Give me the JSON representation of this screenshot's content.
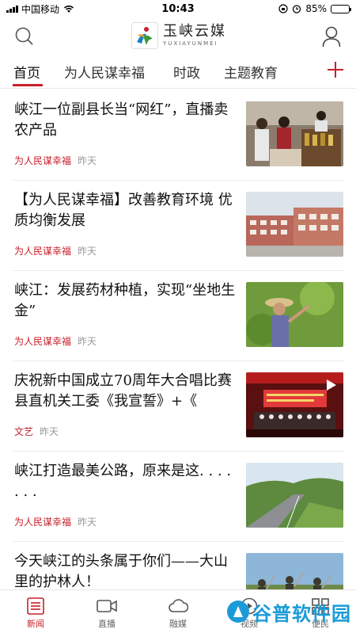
{
  "status": {
    "carrier": "中国移动",
    "time": "10:43",
    "battery": "85%",
    "battery_level": 0.85
  },
  "header": {
    "logo_cn": "玉峡云媒",
    "logo_en": "YUXIAYUNMEI"
  },
  "tabs": [
    {
      "label": "首页",
      "active": true
    },
    {
      "label": "为人民谋幸福",
      "active": false
    },
    {
      "label": "时政",
      "active": false
    },
    {
      "label": "主题教育",
      "active": false
    }
  ],
  "articles": [
    {
      "title": "峡江一位副县长当“网红”，直播卖农产品",
      "category": "为人民谋幸福",
      "time": "昨天",
      "thumb": "market"
    },
    {
      "title": "【为人民谋幸福】改善教育环境 优质均衡发展",
      "category": "为人民谋幸福",
      "time": "昨天",
      "thumb": "school"
    },
    {
      "title": "峡江：发展药材种植，实现“坐地生金”",
      "category": "为人民谋幸福",
      "time": "昨天",
      "thumb": "farmer"
    },
    {
      "title": "庆祝新中国成立70周年大合唱比赛 县直机关工委《我宣誓》+《",
      "category": "文艺",
      "time": "昨天",
      "thumb": "stage"
    },
    {
      "title": "峡江打造最美公路，原来是这. . . . . . .",
      "category": "为人民谋幸福",
      "time": "昨天",
      "thumb": "road"
    },
    {
      "title": "今天峡江的头条属于你们——大山里的护林人！",
      "category": "",
      "time": "",
      "thumb": "forest"
    }
  ],
  "bottom_nav": [
    {
      "label": "新闻",
      "icon": "news-icon",
      "active": true
    },
    {
      "label": "直播",
      "icon": "video-icon",
      "active": false
    },
    {
      "label": "融媒",
      "icon": "cloud-icon",
      "active": false
    },
    {
      "label": "视频",
      "icon": "play-icon",
      "active": false
    },
    {
      "label": "便民",
      "icon": "service-icon",
      "active": false
    }
  ],
  "watermark": "谷普软件园",
  "colors": {
    "accent": "#c8202b",
    "watermark": "#1a9bd7"
  }
}
